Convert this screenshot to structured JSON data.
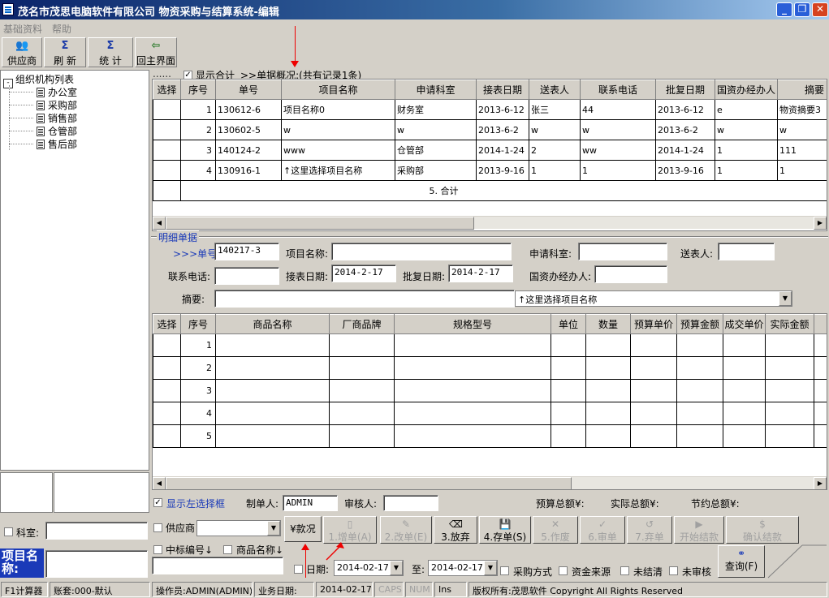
{
  "window": {
    "title": "茂名市茂思电脑软件有限公司 物资采购与结算系统-编辑"
  },
  "menu": [
    "基础资料",
    "帮助"
  ],
  "toolbar": {
    "supplier": "供应商",
    "refresh": "刷 新",
    "stats": "统 计",
    "back": "回主界面"
  },
  "tree": {
    "root": "组织机构列表",
    "items": [
      "办公室",
      "采购部",
      "销售部",
      "仓管部",
      "售后部"
    ]
  },
  "summary": {
    "show_total": "显示合计",
    "overview": ">>单据概况:(共有记录1条)"
  },
  "top_table": {
    "headers": [
      "选择",
      "序号",
      "单号",
      "项目名称",
      "申请科室",
      "接表日期",
      "送表人",
      "联系电话",
      "批复日期",
      "国资办经办人",
      "摘要"
    ],
    "rows": [
      [
        "",
        "1",
        "130612-6",
        "项目名称0",
        "财务室",
        "2013-6-12",
        "张三",
        "44",
        "2013-6-12",
        "e",
        "物资摘要3"
      ],
      [
        "",
        "2",
        "130602-5",
        "w",
        "w",
        "2013-6-2",
        "w",
        "w",
        "2013-6-2",
        "w",
        "w"
      ],
      [
        "",
        "3",
        "140124-2",
        "www",
        "仓管部",
        "2014-1-24",
        "2",
        "ww",
        "2014-1-24",
        "1",
        "111"
      ],
      [
        "",
        "4",
        "130916-1",
        "↑这里选择项目名称",
        "采购部",
        "2013-9-16",
        "1",
        "1",
        "2013-9-16",
        "1",
        "1"
      ]
    ],
    "total_label": "5. 合计"
  },
  "detail": {
    "section": "明细单据",
    "no_label": ">>>单号:",
    "no_value": "140217-3",
    "project_label": "项目名称:",
    "project_value": "",
    "dept_label": "申请科室:",
    "dept_value": "",
    "sender_label": "送表人:",
    "sender_value": "",
    "phone_label": "联系电话:",
    "phone_value": "",
    "recv_date_label": "接表日期:",
    "recv_date_value": "2014-2-17",
    "approve_date_label": "批复日期:",
    "approve_date_value": "2014-2-17",
    "agent_label": "国资办经办人:",
    "agent_value": "",
    "summary_label": "摘要:",
    "summary_value": "",
    "project_select": "↑这里选择项目名称"
  },
  "items_table": {
    "headers": [
      "选择",
      "序号",
      "商品名称",
      "厂商品牌",
      "规格型号",
      "单位",
      "数量",
      "预算单价",
      "预算金额",
      "成交单价",
      "实际金额",
      "备"
    ],
    "rows": [
      [
        "",
        "1"
      ],
      [
        "",
        "2"
      ],
      [
        "",
        "3"
      ],
      [
        "",
        "4"
      ],
      [
        "",
        "5"
      ]
    ]
  },
  "footer": {
    "show_left": "显示左选择框",
    "maker_label": "制单人:",
    "maker_value": "ADMIN",
    "auditor_label": "审核人:",
    "auditor_value": "",
    "budget_total": "预算总额¥:",
    "actual_total": "实际总额¥:",
    "save_total": "节约总额¥:"
  },
  "bottom": {
    "dept_label": "科室:",
    "supplier_label": "供应商",
    "payment": "¥款况",
    "tender_no": "中标编号↓",
    "goods_name": "商品名称↓",
    "project_name_label": "项目名称:",
    "buttons": [
      "1.增单(A)",
      "2.改单(E)",
      "3.放弃",
      "4.存单(S)",
      "5.作废",
      "6.审单",
      "7.弃单",
      "开始结款",
      "确认结款"
    ],
    "date_label": "日期:",
    "date_from": "2014-02-17",
    "date_to_label": "至:",
    "date_to": "2014-02-17",
    "filters": [
      "采购方式",
      "资金来源",
      "未结清",
      "未审核"
    ],
    "query": "查询(F)"
  },
  "statusbar": {
    "calc": "F1计算器",
    "account": "账套:000-默认",
    "operator": "操作员:ADMIN(ADMIN)",
    "biz_date_label": "业务日期:",
    "biz_date": "2014-02-17",
    "caps": "CAPS",
    "num": "NUM",
    "ins": "Ins",
    "copyright": "版权所有:茂思软件 Copyright All Rights Reserved"
  }
}
